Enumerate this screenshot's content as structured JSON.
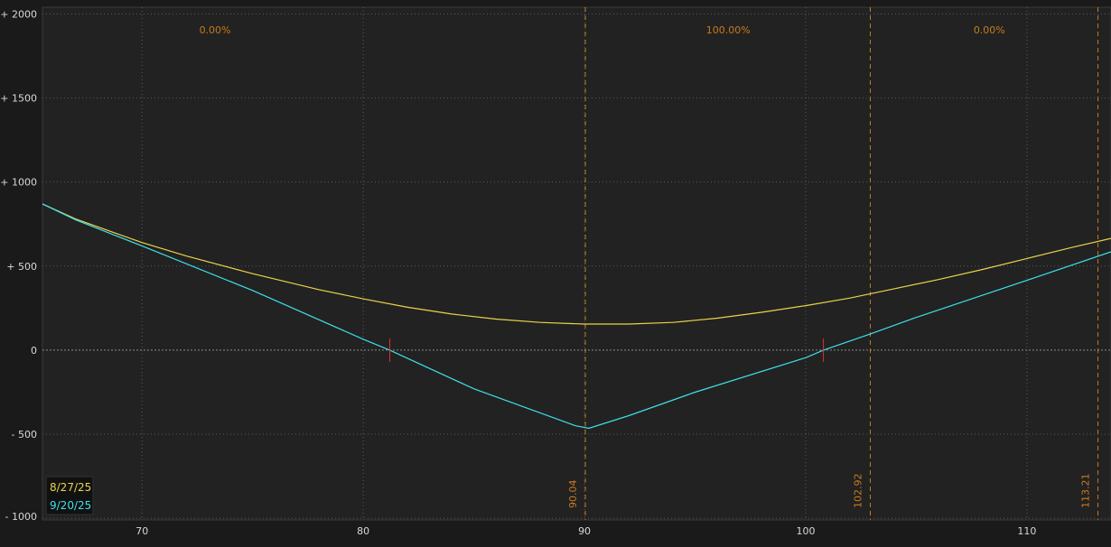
{
  "chart_data": {
    "type": "line",
    "xlim": [
      65.5,
      113.8
    ],
    "ylim": [
      -1010,
      2040
    ],
    "y_ticks": [
      {
        "value": 2000,
        "label": "+ 2000"
      },
      {
        "value": 1500,
        "label": "+ 1500"
      },
      {
        "value": 1000,
        "label": "+ 1000"
      },
      {
        "value": 500,
        "label": "+ 500"
      },
      {
        "value": 0,
        "label": "0"
      },
      {
        "value": -500,
        "label": "- 500"
      },
      {
        "value": -1000,
        "label": "- 1000"
      }
    ],
    "x_ticks": [
      70,
      80,
      90,
      100,
      110
    ],
    "x_tick_labels": [
      "70",
      "80",
      "90",
      "100",
      "110"
    ],
    "grid": true,
    "zero_line": true,
    "series": [
      {
        "name": "8/27/25",
        "color": "#e8d44a",
        "x": [
          65.5,
          67,
          70,
          72,
          75,
          78,
          80,
          82,
          84,
          86,
          88,
          90,
          92,
          94,
          96,
          98,
          100,
          102,
          104,
          106,
          108,
          110,
          112,
          113.8
        ],
        "y": [
          870,
          780,
          640,
          560,
          455,
          360,
          305,
          255,
          215,
          185,
          165,
          155,
          155,
          165,
          190,
          225,
          265,
          310,
          365,
          420,
          480,
          545,
          610,
          665
        ]
      },
      {
        "name": "9/20/25",
        "color": "#3de0e8",
        "x": [
          65.5,
          67,
          70,
          75,
          80,
          81.2,
          85,
          89.6,
          90.2,
          92,
          95,
          100,
          100.8,
          102.9,
          105,
          110,
          113.8
        ],
        "y": [
          870,
          775,
          620,
          355,
          65,
          0,
          -230,
          -450,
          -465,
          -390,
          -250,
          -45,
          0,
          95,
          195,
          415,
          585
        ]
      }
    ],
    "breakeven_x": [
      81.2,
      100.8
    ],
    "vertical_markers": [
      {
        "x": 90.04,
        "label": "90.04"
      },
      {
        "x": 102.92,
        "label": "102.92"
      },
      {
        "x": 113.21,
        "label": "113.21"
      }
    ],
    "probabilities": [
      {
        "x": 73.3,
        "label": "0.00%"
      },
      {
        "x": 96.5,
        "label": "100.00%"
      },
      {
        "x": 108.3,
        "label": "0.00%"
      }
    ],
    "legend_placement": "bottom-left"
  },
  "colors": {
    "background": "#1a1a1a",
    "plot_background": "#222222",
    "grid": "#5a5a5a",
    "marker": "#c87a1e",
    "breakeven": "#e03030"
  }
}
